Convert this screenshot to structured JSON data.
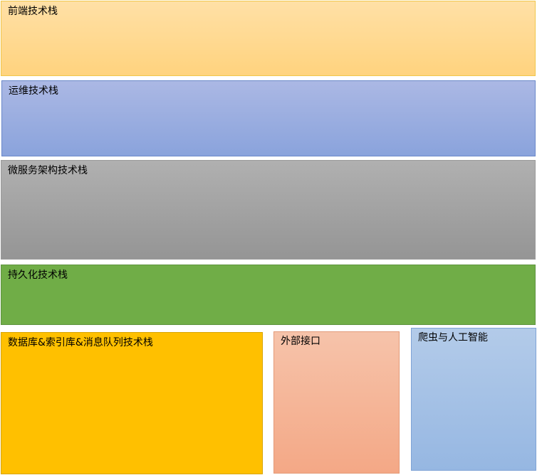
{
  "blocks": {
    "frontend": "前端技术栈",
    "ops": "运维技术栈",
    "microservices": "微服务架构技术栈",
    "persistence": "持久化技术栈",
    "database": "数据库&索引库&消息队列技术栈",
    "external": "外部接口",
    "ai": "爬虫与人工智能"
  },
  "colors": {
    "frontend": "#ffd37e",
    "ops": "#8aa3dc",
    "microservices": "#959595",
    "persistence": "#70ad47",
    "database": "#ffc000",
    "external": "#f4a886",
    "ai": "#96b7e2"
  }
}
